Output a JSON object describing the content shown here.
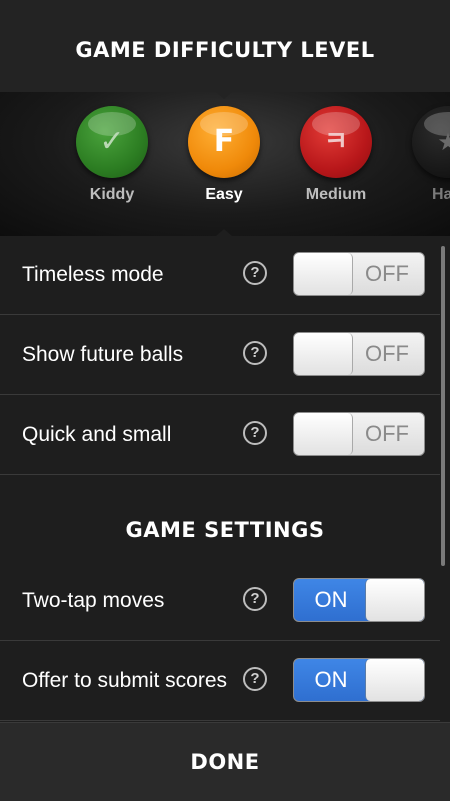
{
  "header": {
    "title": "GAME DIFFICULTY LEVEL"
  },
  "difficulty": {
    "selected": "Easy",
    "levels": [
      {
        "label": "Kiddy",
        "glyph": "✓",
        "color": "#2c7d22",
        "glyph_color": "#b9d8b3",
        "icon": "check-icon"
      },
      {
        "label": "Easy",
        "glyph": "F",
        "color": "#f08a0a",
        "glyph_color": "#ffffff",
        "icon": "easy-badge-icon"
      },
      {
        "label": "Medium",
        "glyph": "ㅋ",
        "color": "#b8171a",
        "glyph_color": "#f0c8c8",
        "icon": "medium-badge-icon"
      },
      {
        "label": "Ha",
        "glyph": "★",
        "color": "#151515",
        "glyph_color": "#6a6a6a",
        "icon": "star-icon"
      }
    ]
  },
  "difficulty_options": [
    {
      "label": "Timeless mode",
      "switch_text": "OFF",
      "on": false
    },
    {
      "label": "Show future balls",
      "switch_text": "OFF",
      "on": false
    },
    {
      "label": "Quick and small",
      "switch_text": "OFF",
      "on": false
    }
  ],
  "game_settings": {
    "title": "GAME SETTINGS",
    "options": [
      {
        "label": "Two-tap moves",
        "switch_text": "ON",
        "on": true
      },
      {
        "label": "Offer to submit scores",
        "switch_text": "ON",
        "on": true
      }
    ]
  },
  "help_glyph": "?",
  "footer": {
    "done_label": "DONE"
  },
  "colors": {
    "switch_on": "#2f6fd0",
    "background": "#1e1e1e",
    "divider": "#3a3a3a"
  }
}
